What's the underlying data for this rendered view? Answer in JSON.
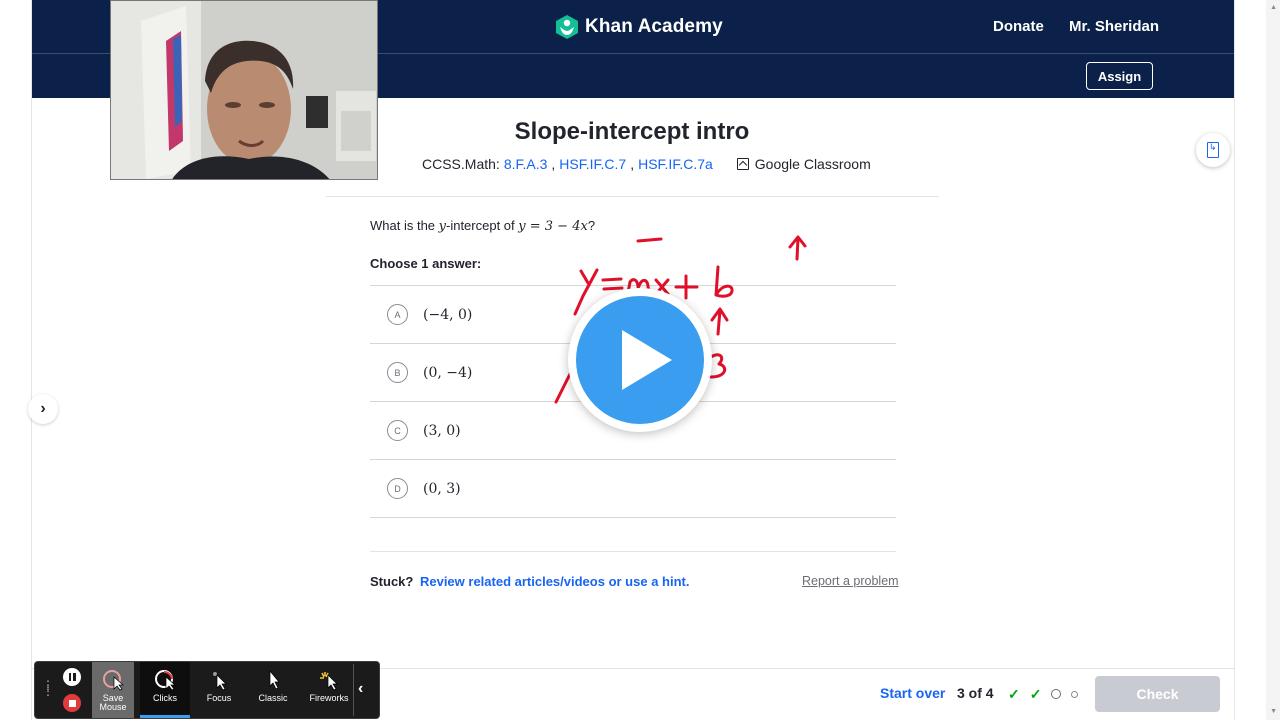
{
  "header": {
    "brand": "Khan Academy",
    "donate": "Donate",
    "user": "Mr. Sheridan",
    "assign": "Assign"
  },
  "lesson": {
    "title": "Slope-intercept intro",
    "standards_prefix": "CCSS.Math:",
    "standards": [
      "8.F.A.3",
      "HSF.IF.C.7",
      "HSF.IF.C.7a"
    ],
    "google_classroom": "Google Classroom"
  },
  "question": {
    "prefix": "What is the ",
    "var": "y",
    "middle": "-intercept of ",
    "equation": "y = 3 − 4x",
    "suffix": "?",
    "choose": "Choose 1 answer:",
    "choices": [
      {
        "letter": "A",
        "value": "(−4, 0)"
      },
      {
        "letter": "B",
        "value": "(0, −4)"
      },
      {
        "letter": "C",
        "value": "(3, 0)"
      },
      {
        "letter": "D",
        "value": "(0, 3)"
      }
    ]
  },
  "help": {
    "stuck": "Stuck?",
    "link": "Review related articles/videos or use a hint.",
    "report": "Report a problem"
  },
  "footer": {
    "start_over": "Start over",
    "progress": "3 of 4",
    "check": "Check"
  },
  "recorder": {
    "tools": [
      "Save Mouse",
      "Clicks",
      "Focus",
      "Classic",
      "Fireworks"
    ]
  },
  "colors": {
    "navy": "#0b2149",
    "link_blue": "#1865f2",
    "play_blue": "#3b9df0",
    "ink_red": "#e0102a",
    "green": "#00a60e"
  }
}
